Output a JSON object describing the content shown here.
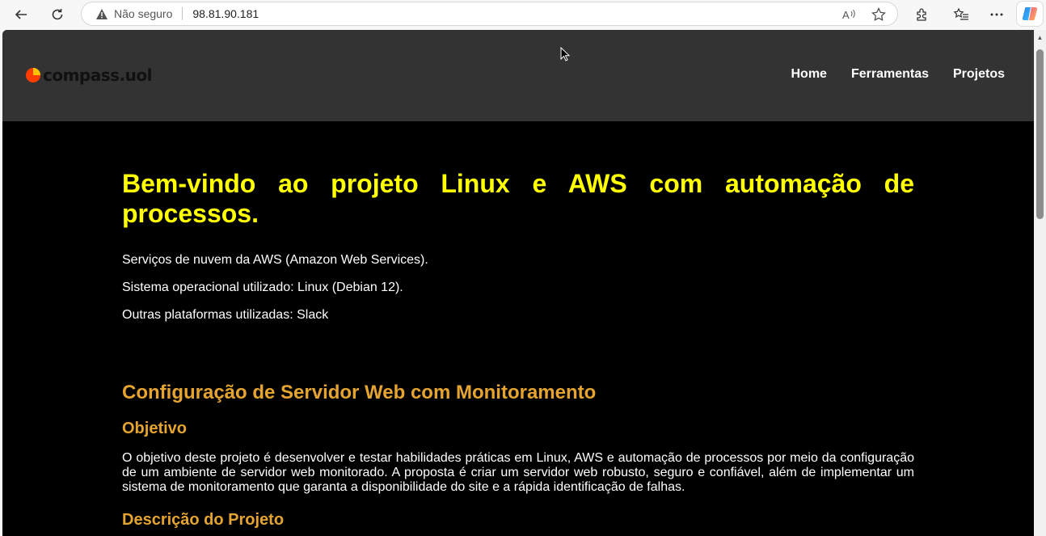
{
  "browser": {
    "security_label": "Não seguro",
    "url": "98.81.90.181"
  },
  "site": {
    "logo_text": "compass.uol",
    "nav": [
      "Home",
      "Ferramentas",
      "Projetos"
    ]
  },
  "welcome": {
    "title": "Bem-vindo ao projeto Linux e AWS com automação de processos.",
    "lines": [
      "Serviços de nuvem da AWS (Amazon Web Services).",
      "Sistema operacional utilizado: Linux (Debian 12).",
      "Outras plataformas utilizadas: Slack"
    ]
  },
  "project": {
    "title": "Configuração de Servidor Web com Monitoramento",
    "objective_heading": "Objetivo",
    "objective_text": "O objetivo deste projeto é desenvolver e testar habilidades práticas em Linux, AWS e automação de processos por meio da configuração de um ambiente de servidor web monitorado. A proposta é criar um servidor web robusto, seguro e confiável, além de implementar um sistema de monitoramento que garanta a disponibilidade do site e a rápida identificação de falhas.",
    "description_heading": "Descrição do Projeto"
  },
  "colors": {
    "header_bg": "#333333",
    "page_bg": "#000000",
    "title_yellow": "#ffff00",
    "section_orange": "#e5a430"
  }
}
